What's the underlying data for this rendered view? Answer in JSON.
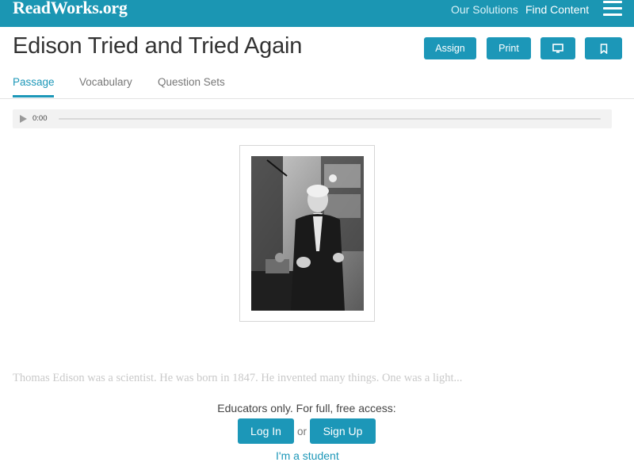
{
  "header": {
    "logo": "ReadWorks.org",
    "nav": {
      "solutions": "Our Solutions",
      "find_content": "Find Content"
    }
  },
  "article": {
    "title": "Edison Tried and Tried Again"
  },
  "toolbar": {
    "assign_label": "Assign",
    "print_label": "Print"
  },
  "tabs": {
    "passage": "Passage",
    "vocabulary": "Vocabulary",
    "question_sets": "Question Sets"
  },
  "audio": {
    "time": "0:00"
  },
  "passage": {
    "preview": "Thomas Edison was a scientist. He was born in 1847. He invented many things. One was a light..."
  },
  "access": {
    "message": "Educators only. For full, free access:",
    "login_label": "Log In",
    "or_label": "or",
    "signup_label": "Sign Up",
    "student_label": "I'm a student"
  },
  "colors": {
    "brand": "#1b96b3",
    "button": "#1c97b8"
  }
}
